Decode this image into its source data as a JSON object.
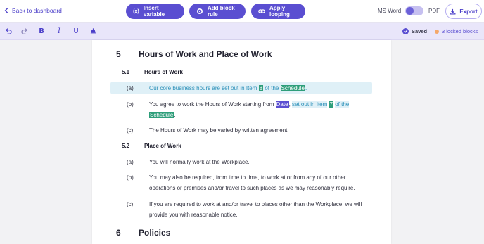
{
  "topbar": {
    "back_label": "Back to dashboard",
    "insert_variable": "Insert variable",
    "insert_variable_icon": "(x)",
    "add_block_rule": "Add block rule",
    "apply_looping": "Apply looping",
    "format_word": "MS Word",
    "format_pdf": "PDF",
    "export": "Export"
  },
  "toolbar": {
    "saved": "Saved",
    "locked": "3 locked blocks",
    "bold": "B",
    "italic": "I",
    "underline": "U"
  },
  "document": {
    "section5": {
      "num": "5",
      "title": "Hours of Work and Place of Work"
    },
    "s51": {
      "num": "5.1",
      "title": "Hours of Work"
    },
    "a1": {
      "label": "(a)",
      "pre": "Our core business hours are set out in Item",
      "item": "8",
      "mid": "of the",
      "schedule": "Schedule",
      "post": "."
    },
    "b1": {
      "label": "(b)",
      "pre": "You agree to work the Hours of Work starting from",
      "date": "Date",
      "comma": ",",
      "loop": "set out in Item",
      "item": "7",
      "loop2": "of the",
      "schedule": "Schedule",
      "post": "."
    },
    "c1": {
      "label": "(c)",
      "text": "The Hours of Work may be varied by written agreement."
    },
    "s52": {
      "num": "5.2",
      "title": "Place of Work"
    },
    "a2": {
      "label": "(a)",
      "text": "You will normally work at the Workplace."
    },
    "b2": {
      "label": "(b)",
      "line1": "You may also be required, from time to time, to work at or from any of our other",
      "line2": "operations or premises and/or travel to such places as we may reasonably require."
    },
    "c2": {
      "label": "(c)",
      "line1": "If you are required to work at and/or travel to places other than the Workplace, we will",
      "line2": "provide you with reasonable notice."
    },
    "section6": {
      "num": "6",
      "title": "Policies"
    }
  },
  "colors": {
    "accent": "#5a4ed1",
    "variable": "#2e9e7a",
    "highlight": "#dff0f7",
    "loop_text": "#2a8fb8"
  }
}
